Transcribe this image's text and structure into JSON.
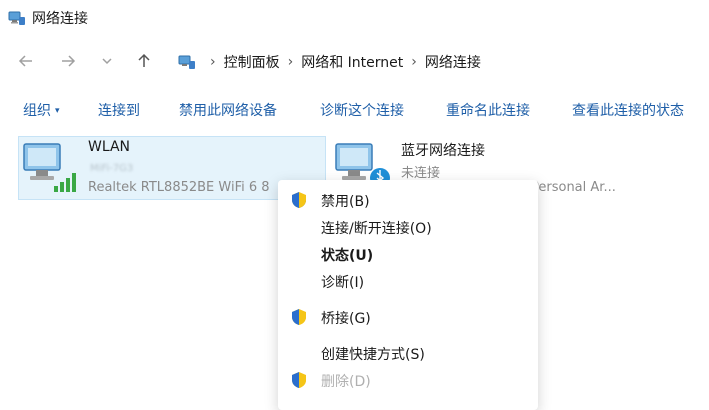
{
  "window": {
    "title": "网络连接"
  },
  "nav": {
    "back_icon": "arrow-left-icon",
    "forward_icon": "arrow-right-icon",
    "recent_icon": "chevron-down-icon",
    "up_icon": "arrow-up-icon"
  },
  "breadcrumb": {
    "items": [
      "控制面板",
      "网络和 Internet",
      "网络连接"
    ],
    "separator": ">"
  },
  "commands": {
    "organize": "组织",
    "connect_to": "连接到",
    "disable_device": "禁用此网络设备",
    "diagnose": "诊断这个连接",
    "rename": "重命名此连接",
    "view_status": "查看此连接的状态"
  },
  "connections": [
    {
      "name": "WLAN",
      "ssid": "MiFi-7G3",
      "adapter": "Realtek RTL8852BE WiFi 6 8",
      "icon": "wifi-adapter-icon",
      "selected": true
    },
    {
      "name": "蓝牙网络连接",
      "status": "未连接",
      "adapter": "Personal Ar...",
      "icon": "bluetooth-adapter-icon"
    }
  ],
  "context_menu": {
    "items": [
      {
        "label": "禁用(B)",
        "shield": true
      },
      {
        "label": "连接/断开连接(O)"
      },
      {
        "label": "状态(U)",
        "bold": true
      },
      {
        "label": "诊断(I)"
      },
      {
        "label": "桥接(G)",
        "shield": true
      },
      {
        "label": "创建快捷方式(S)"
      },
      {
        "label": "删除(D)",
        "shield": true,
        "disabled": true
      }
    ]
  },
  "colors": {
    "accent": "#1f5fa8",
    "selection": "#e5f3fb",
    "shield_blue": "#2b6fce",
    "shield_yellow": "#f5c518"
  }
}
